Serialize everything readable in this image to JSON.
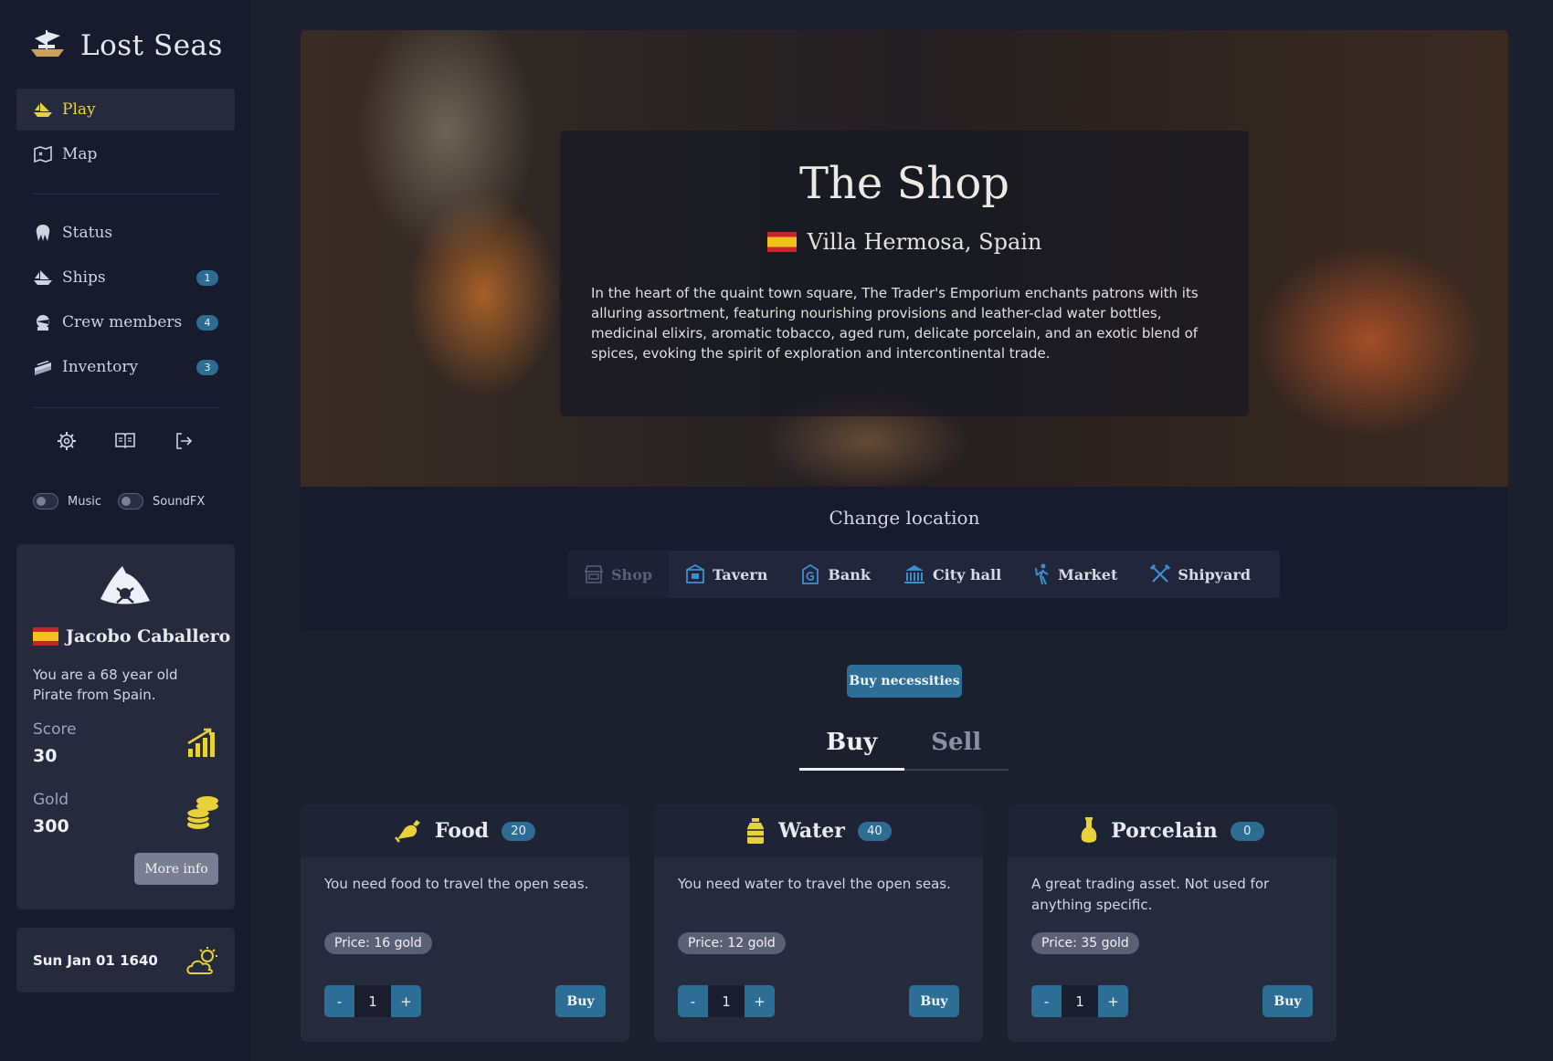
{
  "app": {
    "title": "Lost Seas"
  },
  "sidebar": {
    "nav": [
      {
        "label": "Play",
        "icon": "play-ship-icon",
        "active": true
      },
      {
        "label": "Map",
        "icon": "map-icon"
      }
    ],
    "status_nav": [
      {
        "label": "Status",
        "icon": "status-icon"
      },
      {
        "label": "Ships",
        "icon": "ships-icon",
        "badge": "1"
      },
      {
        "label": "Crew members",
        "icon": "crew-icon",
        "badge": "4"
      },
      {
        "label": "Inventory",
        "icon": "inventory-icon",
        "badge": "3"
      }
    ],
    "tools": [
      "settings-gear-icon",
      "guide-book-icon",
      "logout-icon"
    ],
    "toggles": {
      "music": "Music",
      "soundfx": "SoundFX"
    },
    "player": {
      "name": "Jacobo Caballero",
      "description": "You are a 68 year old Pirate from Spain.",
      "score_label": "Score",
      "score": "30",
      "gold_label": "Gold",
      "gold": "300",
      "more_info": "More info"
    },
    "date": "Sun Jan 01 1640"
  },
  "hero": {
    "title": "The Shop",
    "location": "Villa Hermosa, Spain",
    "description": "In the heart of the quaint town square, The Trader's Emporium enchants patrons with its alluring assortment, featuring nourishing provisions and leather-clad water bottles, medicinal elixirs, aromatic tobacco, aged rum, delicate porcelain, and an exotic blend of spices, evoking the spirit of exploration and intercontinental trade."
  },
  "locations": {
    "heading": "Change location",
    "tabs": [
      {
        "label": "Shop",
        "icon": "shop-icon",
        "disabled": true
      },
      {
        "label": "Tavern",
        "icon": "tavern-icon"
      },
      {
        "label": "Bank",
        "icon": "bank-icon"
      },
      {
        "label": "City hall",
        "icon": "city-hall-icon"
      },
      {
        "label": "Market",
        "icon": "market-icon"
      },
      {
        "label": "Shipyard",
        "icon": "shipyard-icon"
      }
    ]
  },
  "actions": {
    "buy_necessities": "Buy necessities"
  },
  "trade_tabs": {
    "buy": "Buy",
    "sell": "Sell"
  },
  "items": [
    {
      "name": "Food",
      "icon": "food-icon",
      "count": "20",
      "description": "You need food to travel the open seas.",
      "price": "Price: 16 gold",
      "qty": "1",
      "buy": "Buy"
    },
    {
      "name": "Water",
      "icon": "water-icon",
      "count": "40",
      "description": "You need water to travel the open seas.",
      "price": "Price: 12 gold",
      "qty": "1",
      "buy": "Buy"
    },
    {
      "name": "Porcelain",
      "icon": "porcelain-icon",
      "count": "0",
      "description": "A great trading asset. Not used for anything specific.",
      "price": "Price: 35 gold",
      "qty": "1",
      "buy": "Buy"
    }
  ],
  "stepper": {
    "minus": "-",
    "plus": "+"
  },
  "colors": {
    "accent": "#e8d23a",
    "primary": "#2d6e96",
    "sidebar": "#181b2d",
    "card": "#262a3d"
  }
}
